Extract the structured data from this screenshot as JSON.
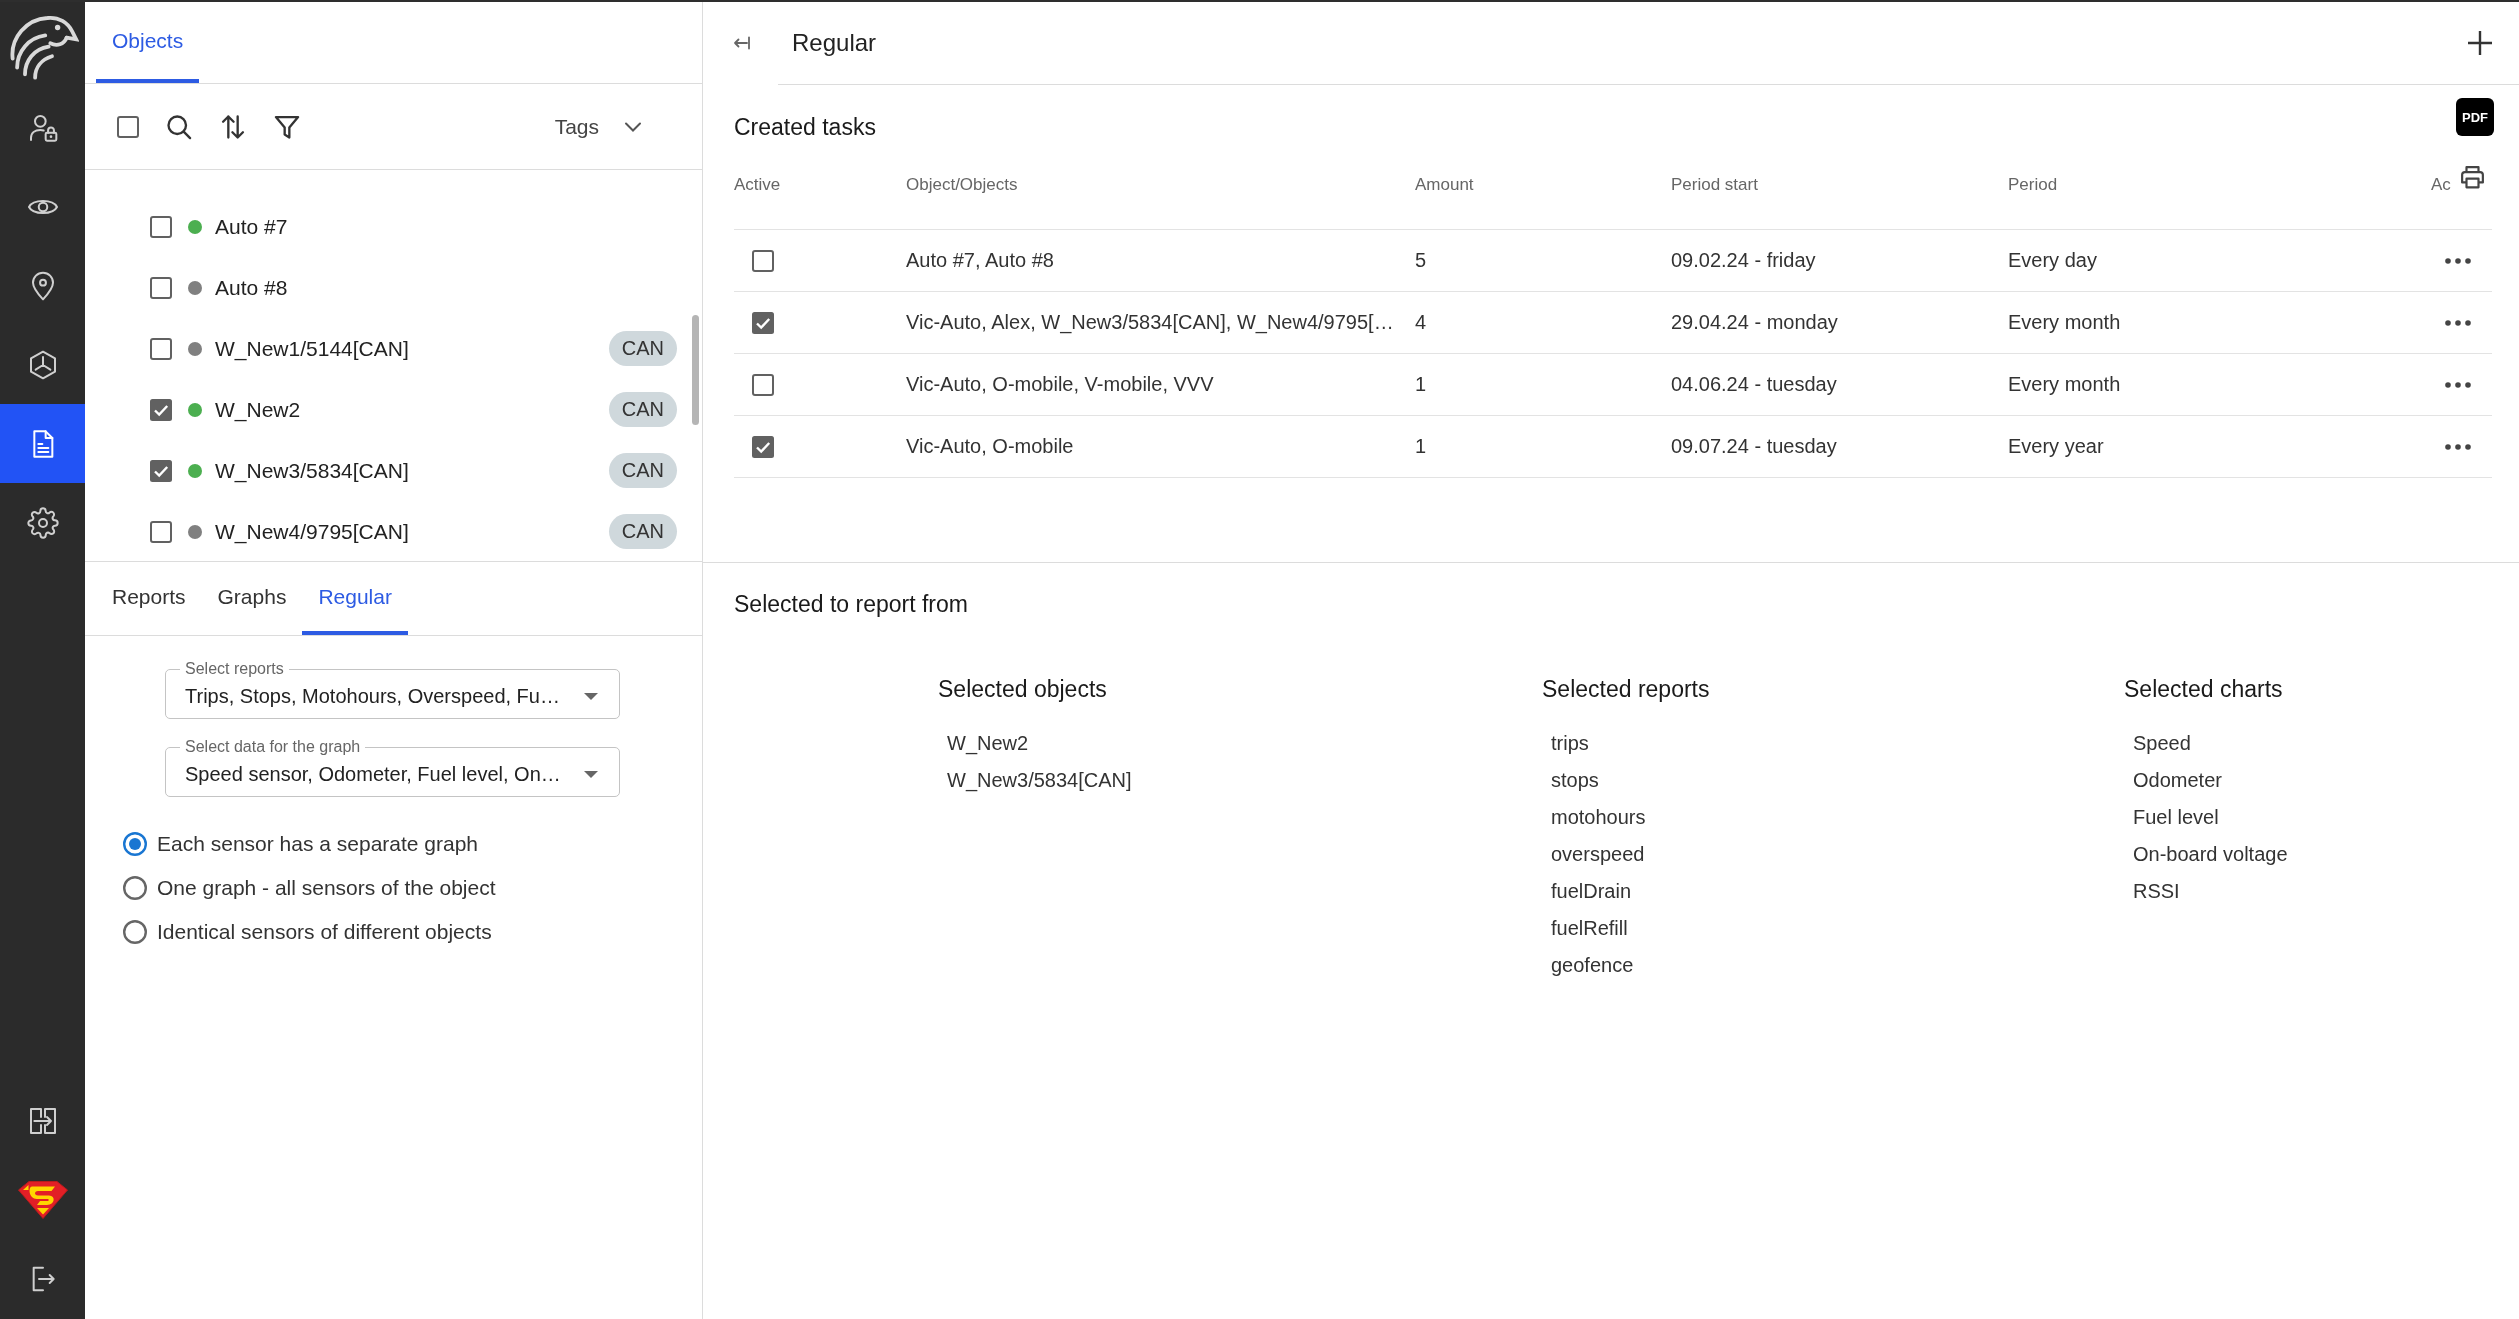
{
  "nav": {
    "items": [
      {
        "selected": false
      },
      {
        "selected": false
      },
      {
        "selected": false
      },
      {
        "selected": false
      },
      {
        "selected": true
      },
      {
        "selected": false
      }
    ]
  },
  "objects_panel": {
    "tabs": [
      {
        "label": "Objects",
        "selected": true
      }
    ],
    "select_all": {
      "checked": false
    },
    "tags_label": "Tags",
    "objects": [
      {
        "name": "Auto #7",
        "checked": false,
        "color": "#4caf50"
      },
      {
        "name": "Auto #8",
        "checked": false,
        "color": "#808080"
      },
      {
        "name": "W_New1/5144[CAN]",
        "checked": false,
        "color": "#808080",
        "tag": "CAN"
      },
      {
        "name": "W_New2",
        "checked": true,
        "color": "#4caf50",
        "tag": "CAN"
      },
      {
        "name": "W_New3/5834[CAN]",
        "checked": true,
        "color": "#4caf50",
        "tag": "CAN"
      },
      {
        "name": "W_New4/9795[CAN]",
        "checked": false,
        "color": "#808080",
        "tag": "CAN"
      }
    ]
  },
  "report_panel": {
    "tabs": [
      {
        "label": "Reports",
        "selected": false
      },
      {
        "label": "Graphs",
        "selected": false
      },
      {
        "label": "Regular",
        "selected": true
      }
    ],
    "selects": [
      {
        "label": "Select reports",
        "value": "Trips, Stops, Motohours, Overspeed, Fu…"
      },
      {
        "label": "Select data for the graph",
        "value": "Speed sensor, Odometer, Fuel level, On…"
      }
    ],
    "graph_modes": [
      {
        "label": "Each sensor has a separate graph",
        "selected": true
      },
      {
        "label": "One graph - all sensors of the object",
        "selected": false
      },
      {
        "label": "Identical sensors of different objects",
        "selected": false
      }
    ]
  },
  "main": {
    "title": "Regular",
    "created_tasks": {
      "title": "Created tasks",
      "pdf_label": "PDF",
      "columns": [
        "Active",
        "Object/Objects",
        "Amount",
        "Period start",
        "Period",
        "Ac"
      ],
      "rows": [
        {
          "active": false,
          "objects": "Auto #7, Auto #8",
          "amount": "5",
          "period_start": "09.02.24 - friday",
          "period": "Every day"
        },
        {
          "active": true,
          "objects": "Vic-Auto, Alex, W_New3/5834[CAN], W_New4/9795[…",
          "amount": "4",
          "period_start": "29.04.24 - monday",
          "period": "Every month"
        },
        {
          "active": false,
          "objects": "Vic-Auto, O-mobile, V-mobile, VVV",
          "amount": "1",
          "period_start": "04.06.24 - tuesday",
          "period": "Every month"
        },
        {
          "active": true,
          "objects": "Vic-Auto, O-mobile",
          "amount": "1",
          "period_start": "09.07.24 - tuesday",
          "period": "Every year"
        }
      ]
    },
    "selection": {
      "title": "Selected to report from",
      "groups": [
        {
          "title": "Selected objects",
          "items": [
            "W_New2",
            "W_New3/5834[CAN]"
          ]
        },
        {
          "title": "Selected reports",
          "items": [
            "trips",
            "stops",
            "motohours",
            "overspeed",
            "fuelDrain",
            "fuelRefill",
            "geofence"
          ]
        },
        {
          "title": "Selected charts",
          "items": [
            "Speed",
            "Odometer",
            "Fuel level",
            "On-board voltage",
            "RSSI"
          ]
        }
      ]
    }
  }
}
